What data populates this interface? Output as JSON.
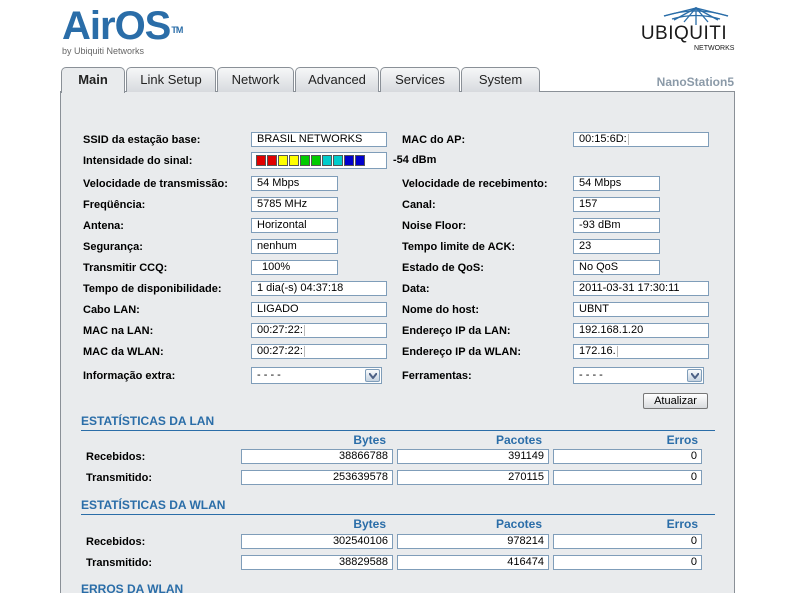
{
  "header": {
    "logo": "AirOS",
    "logo_tm": "TM",
    "logo_sub": "by Ubiquiti Networks",
    "brand": "UBIQUITI",
    "brand_sub": "NETWORKS"
  },
  "tabs": [
    {
      "label": "Main",
      "active": true
    },
    {
      "label": "Link Setup"
    },
    {
      "label": "Network"
    },
    {
      "label": "Advanced"
    },
    {
      "label": "Services"
    },
    {
      "label": "System"
    }
  ],
  "device_name": "NanoStation5",
  "status": {
    "ssid_label": "SSID da estação base:",
    "ssid": "BRASIL NETWORKS",
    "ap_mac_label": "MAC do AP:",
    "ap_mac": "00:15:6D:",
    "signal_label": "Intensidade do sinal:",
    "signal": "-54 dBm",
    "signal_bars_filled": 10,
    "signal_colors": [
      "#e00000",
      "#e00000",
      "#ffff00",
      "#ffff00",
      "#00cc00",
      "#00cc00",
      "#00cccc",
      "#00cccc",
      "#0000cc",
      "#0000cc"
    ],
    "tx_rate_label": "Velocidade de transmissão:",
    "tx_rate": "54 Mbps",
    "rx_rate_label": "Velocidade de recebimento:",
    "rx_rate": "54 Mbps",
    "freq_label": "Freqüência:",
    "freq": "5785 MHz",
    "channel_label": "Canal:",
    "channel": "157",
    "antenna_label": "Antena:",
    "antenna": "Horizontal",
    "noise_label": "Noise Floor:",
    "noise": "-93 dBm",
    "security_label": "Segurança:",
    "security": "nenhum",
    "ack_label": "Tempo limite de ACK:",
    "ack": "23",
    "ccq_label": "Transmitir CCQ:",
    "ccq": "100%",
    "qos_label": "Estado de QoS:",
    "qos": "No QoS",
    "uptime_label": "Tempo de disponibilidade:",
    "uptime": "1 dia(-s) 04:37:18",
    "date_label": "Data:",
    "date": "2011-03-31 17:30:11",
    "cable_label": "Cabo LAN:",
    "cable": "LIGADO",
    "host_label": "Nome do host:",
    "host": "UBNT",
    "lan_mac_label": "MAC na LAN:",
    "lan_mac": "00:27:22:",
    "lan_ip_label": "Endereço IP da LAN:",
    "lan_ip": "192.168.1.20",
    "wlan_mac_label": "MAC da WLAN:",
    "wlan_mac": "00:27:22:",
    "wlan_ip_label": "Endereço IP da WLAN:",
    "wlan_ip": "172.16.",
    "extra_label": "Informação extra:",
    "extra": "- - - -",
    "tools_label": "Ferramentas:",
    "tools": "- - - -",
    "refresh": "Atualizar"
  },
  "lan_stats": {
    "title": "ESTATÍSTICAS DA LAN",
    "columns": [
      "Bytes",
      "Pacotes",
      "Erros"
    ],
    "rows": [
      {
        "label": "Recebidos:",
        "bytes": "38866788",
        "packets": "391149",
        "errors": "0"
      },
      {
        "label": "Transmitido:",
        "bytes": "253639578",
        "packets": "270115",
        "errors": "0"
      }
    ]
  },
  "wlan_stats": {
    "title": "ESTATÍSTICAS DA WLAN",
    "columns": [
      "Bytes",
      "Pacotes",
      "Erros"
    ],
    "rows": [
      {
        "label": "Recebidos:",
        "bytes": "302540106",
        "packets": "978214",
        "errors": "0"
      },
      {
        "label": "Transmitido:",
        "bytes": "38829588",
        "packets": "416474",
        "errors": "0"
      }
    ]
  },
  "wlan_errors": {
    "title": "ERROS DA WLAN"
  }
}
